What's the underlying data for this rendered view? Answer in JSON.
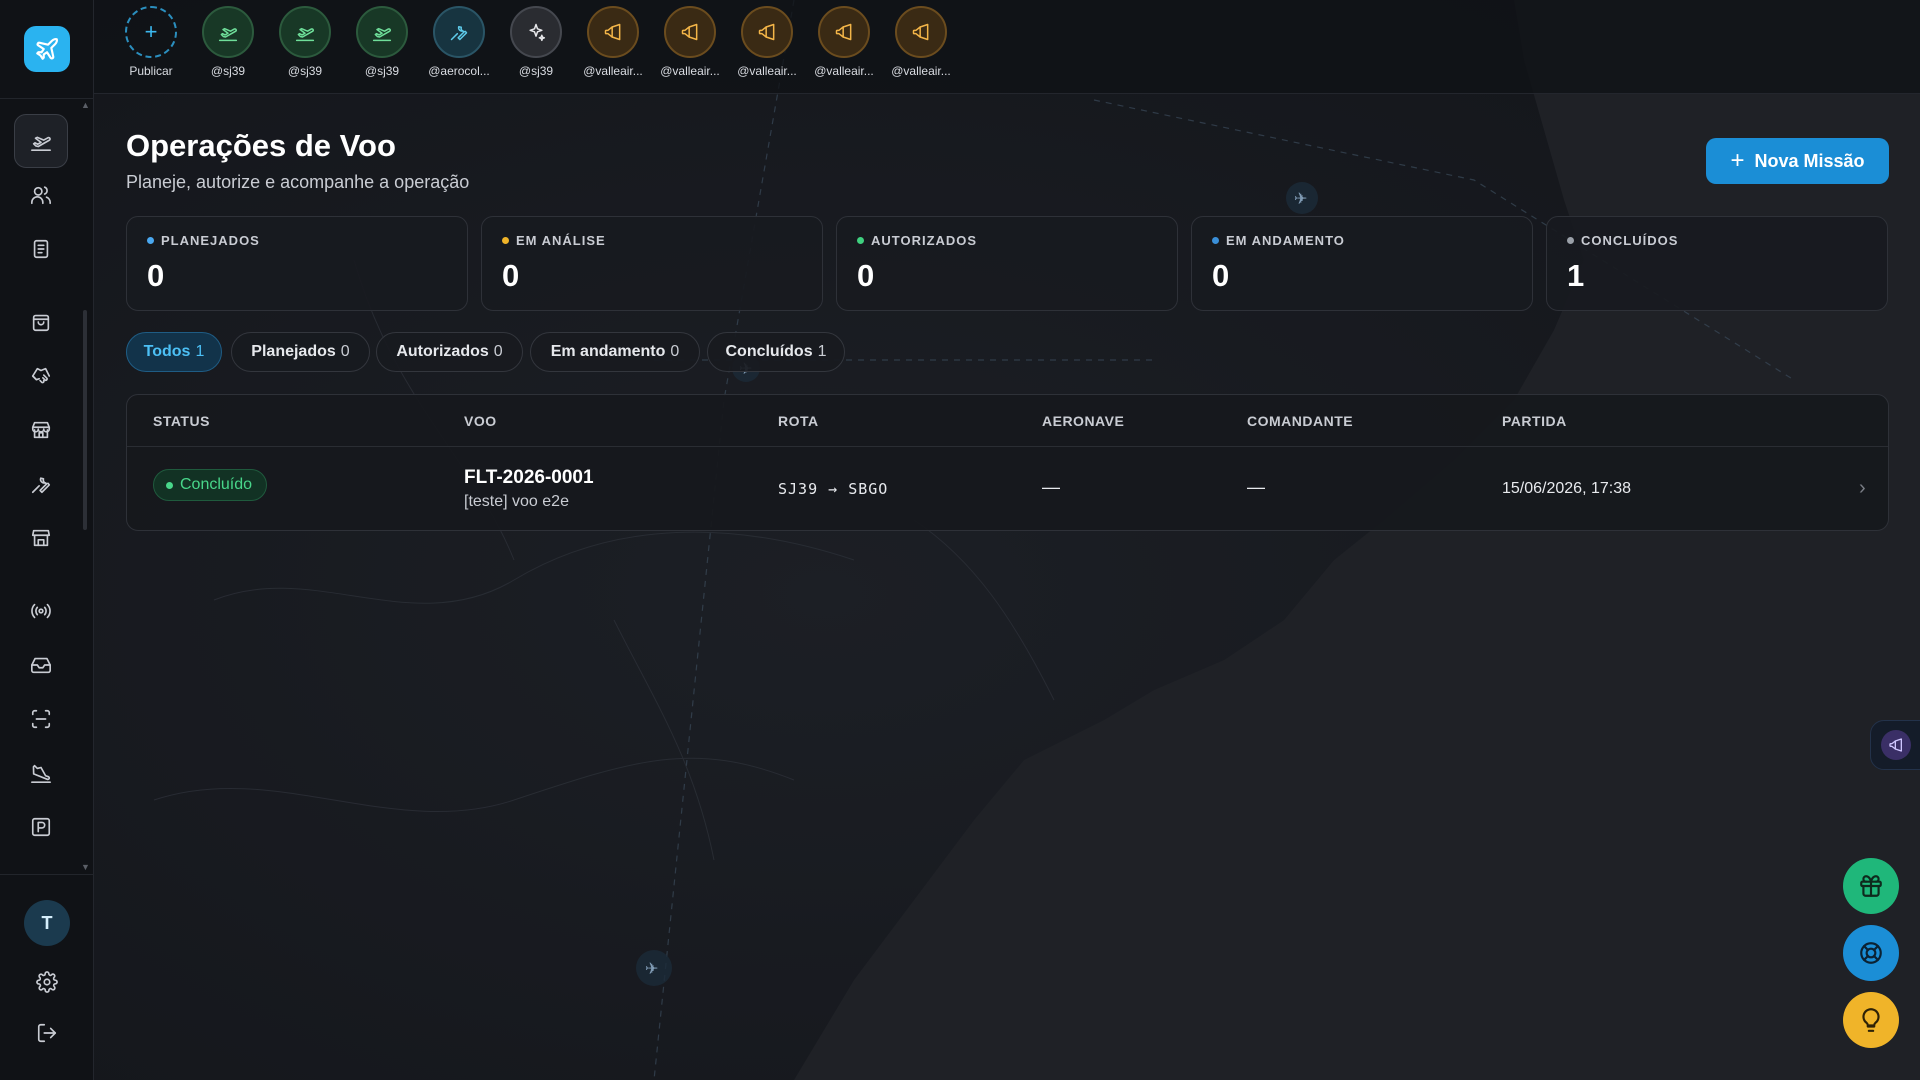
{
  "colors": {
    "accent": "#1b8ed6",
    "planejados_dot": "#4aa8f0",
    "em_analise_dot": "#f0b429",
    "autorizados_dot": "#3fd07f",
    "em_andamento_dot": "#3a8fd8",
    "concluidos_dot": "#9aa0a8",
    "status_success": "#48d68a"
  },
  "sidebar": {
    "logo_icon": "plane-icon",
    "nav_items": [
      {
        "icon": "flight-takeoff-icon",
        "active": true
      },
      {
        "icon": "users-icon"
      },
      {
        "icon": "document-icon"
      },
      {
        "icon": "shopping-bag-icon"
      },
      {
        "icon": "handshake-icon"
      },
      {
        "icon": "store-icon"
      },
      {
        "icon": "wrench-icon"
      },
      {
        "icon": "storefront-icon"
      },
      {
        "icon": "broadcast-icon"
      },
      {
        "icon": "inbox-icon"
      },
      {
        "icon": "scan-icon"
      },
      {
        "icon": "landing-icon"
      },
      {
        "icon": "parking-icon"
      }
    ],
    "avatar_initial": "T",
    "settings_icon": "gear-icon",
    "logout_icon": "logout-icon"
  },
  "stories": [
    {
      "label": "Publicar",
      "icon": "plus-icon",
      "style": "add"
    },
    {
      "label": "@sj39",
      "icon": "flight-takeoff-icon",
      "style": "green"
    },
    {
      "label": "@sj39",
      "icon": "flight-takeoff-icon",
      "style": "green"
    },
    {
      "label": "@sj39",
      "icon": "flight-takeoff-icon",
      "style": "green"
    },
    {
      "label": "@aerocol...",
      "icon": "wrench-icon",
      "style": "teal"
    },
    {
      "label": "@sj39",
      "icon": "sparkles-icon",
      "style": "gray"
    },
    {
      "label": "@valleair...",
      "icon": "megaphone-icon",
      "style": "amber"
    },
    {
      "label": "@valleair...",
      "icon": "megaphone-icon",
      "style": "amber"
    },
    {
      "label": "@valleair...",
      "icon": "megaphone-icon",
      "style": "amber"
    },
    {
      "label": "@valleair...",
      "icon": "megaphone-icon",
      "style": "amber"
    },
    {
      "label": "@valleair...",
      "icon": "megaphone-icon",
      "style": "amber"
    }
  ],
  "header": {
    "title": "Operações de Voo",
    "subtitle": "Planeje, autorize e acompanhe a operação",
    "new_button_label": "Nova Missão"
  },
  "stats": [
    {
      "label": "PLANEJADOS",
      "value": "0"
    },
    {
      "label": "EM ANÁLISE",
      "value": "0"
    },
    {
      "label": "AUTORIZADOS",
      "value": "0"
    },
    {
      "label": "EM ANDAMENTO",
      "value": "0"
    },
    {
      "label": "CONCLUÍDOS",
      "value": "1"
    }
  ],
  "filters": [
    {
      "label": "Todos",
      "count": "1",
      "active": true
    },
    {
      "label": "Planejados",
      "count": "0"
    },
    {
      "label": "Autorizados",
      "count": "0"
    },
    {
      "label": "Em andamento",
      "count": "0"
    },
    {
      "label": "Concluídos",
      "count": "1"
    }
  ],
  "table": {
    "columns": [
      "STATUS",
      "VOO",
      "ROTA",
      "AERONAVE",
      "COMANDANTE",
      "PARTIDA"
    ],
    "rows": [
      {
        "status": "Concluído",
        "flight_id": "FLT-2026-0001",
        "flight_desc": "[teste] voo e2e",
        "route": "SJ39 → SBGO",
        "aircraft": "—",
        "commander": "—",
        "departure": "15/06/2026, 17:38",
        "chevron": "›"
      }
    ]
  },
  "floating": {
    "side_tab_icon": "megaphone-icon",
    "fab_gift_icon": "gift-icon",
    "fab_support_icon": "lifebuoy-icon",
    "fab_ideas_icon": "lightbulb-icon"
  }
}
